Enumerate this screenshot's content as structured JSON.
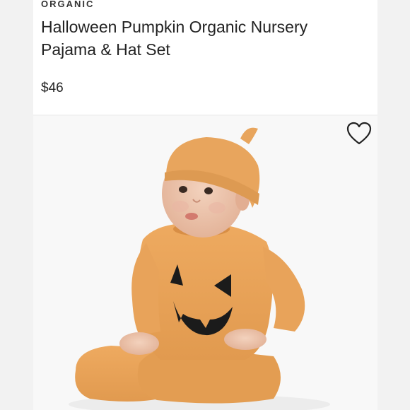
{
  "product": {
    "brand": "ORGANIC",
    "title": "Halloween Pumpkin Organic Nursery Pajama & Hat Set",
    "price": "$46"
  },
  "icons": {
    "favorite": "heart-outline-icon"
  },
  "colors": {
    "pajama": "#e9a45c",
    "face": "#1b1b1b",
    "background": "#f8f8f8"
  }
}
